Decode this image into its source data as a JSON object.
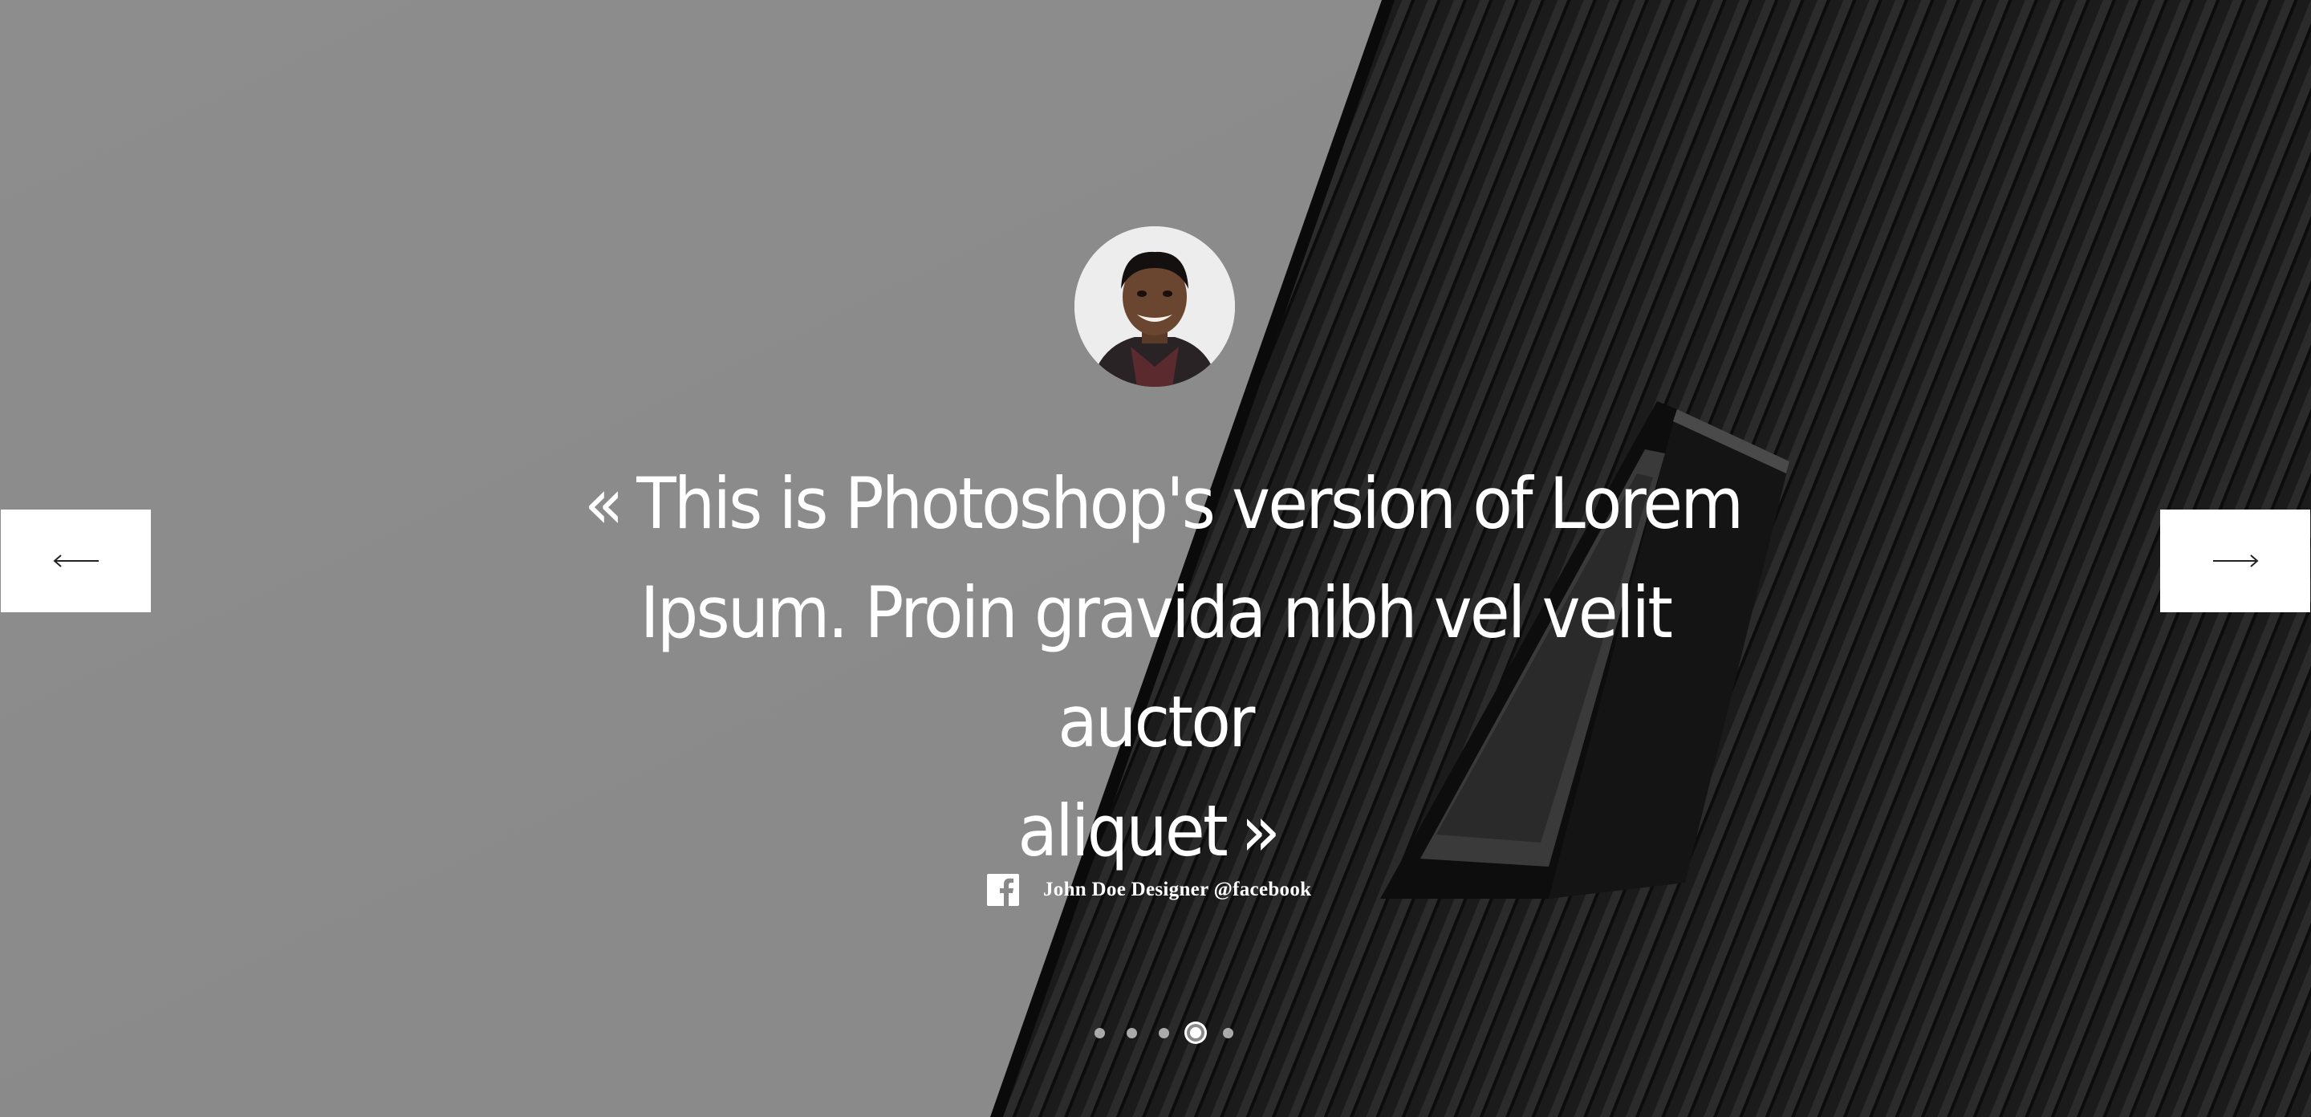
{
  "testimonial": {
    "quote_open": "«",
    "quote_line_1": "This is Photoshop's version  of Lorem",
    "quote_line_2": "Ipsum. Proin gravida nibh vel velit auctor",
    "quote_line_3": "aliquet",
    "quote_close": "»",
    "author": "John Doe Designer @facebook",
    "author_icon": "facebook-icon"
  },
  "navigation": {
    "prev_icon": "arrow-left-icon",
    "next_icon": "arrow-right-icon"
  },
  "pagination": {
    "total": 5,
    "active_index": 3
  },
  "colors": {
    "left_background": "#8b8b8b",
    "right_background": "#1c1c1c",
    "text": "#ffffff",
    "button_background": "#ffffff"
  }
}
